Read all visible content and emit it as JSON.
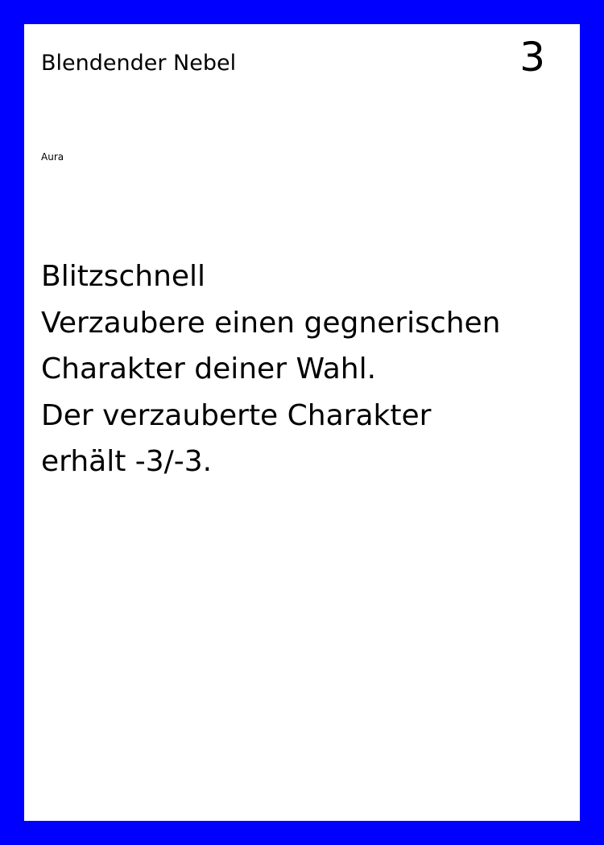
{
  "card": {
    "title": "Blendender Nebel",
    "cost": "3",
    "type": "Aura",
    "rules_lines": [
      "Blitzschnell",
      "Verzaubere einen gegnerischen",
      "Charakter deiner Wahl.",
      "Der verzauberte Charakter",
      "erhält -3/-3."
    ]
  },
  "colors": {
    "border": "#0000ff",
    "card_background": "#ffffff",
    "text": "#000000"
  }
}
